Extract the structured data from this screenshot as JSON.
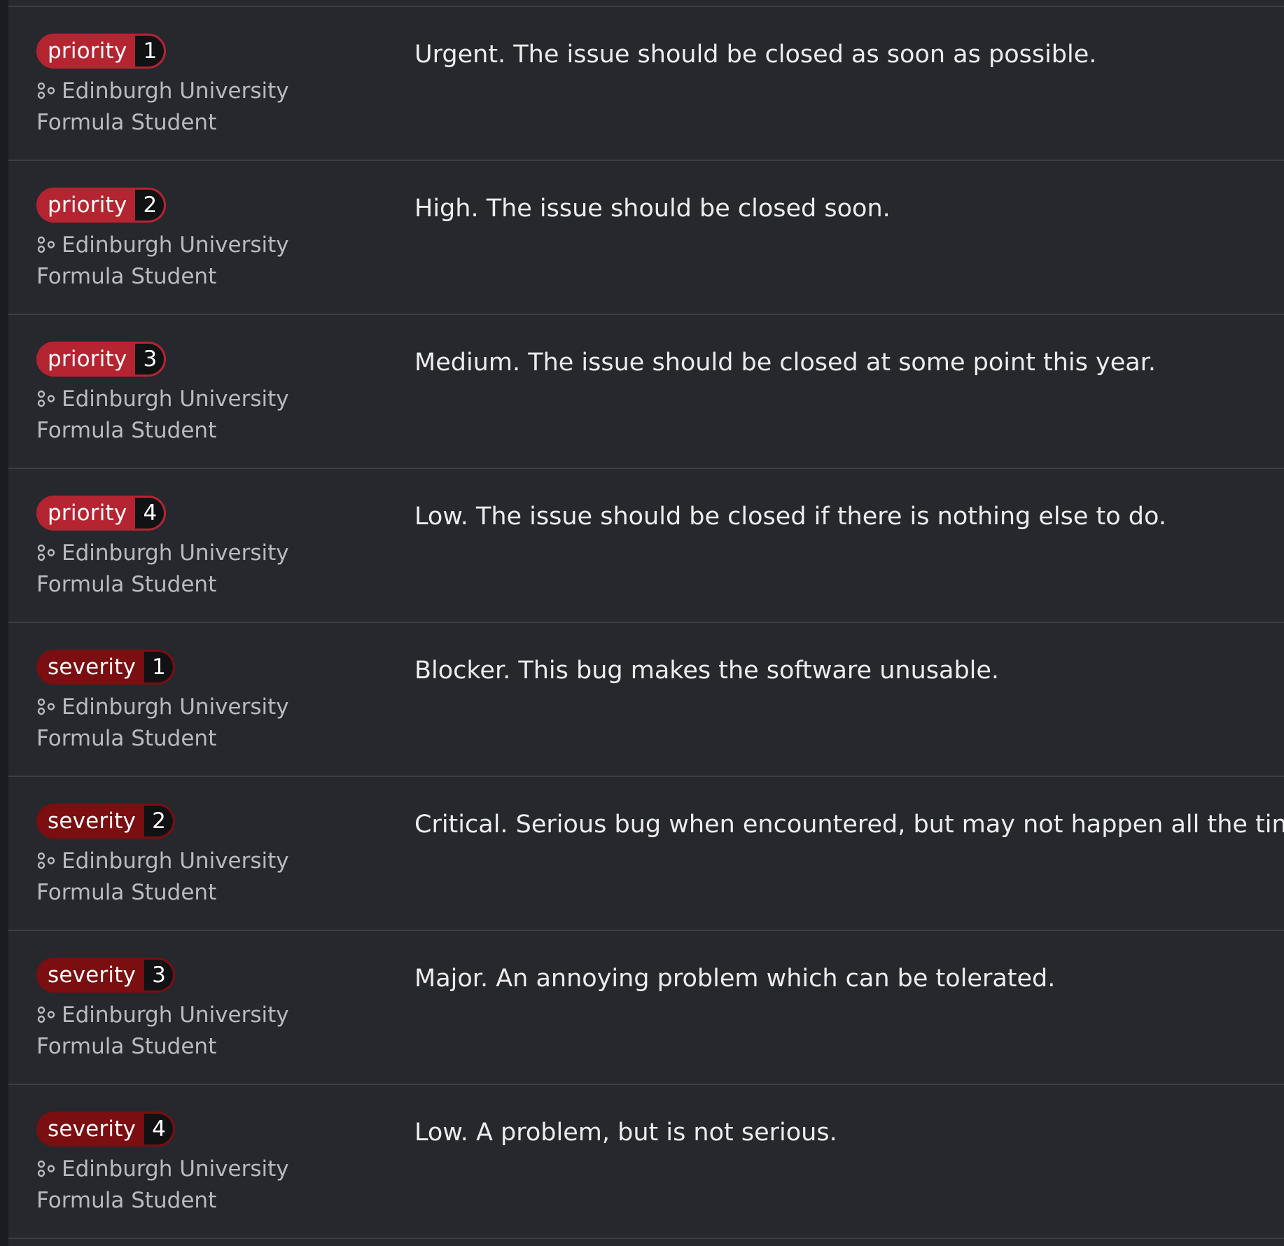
{
  "labels": [
    {
      "scope": "priority",
      "value": "1",
      "kind": "priority",
      "namespace": "Edinburgh University Formula Student",
      "description": "Urgent. The issue should be closed as soon as possible."
    },
    {
      "scope": "priority",
      "value": "2",
      "kind": "priority",
      "namespace": "Edinburgh University Formula Student",
      "description": "High. The issue should be closed soon."
    },
    {
      "scope": "priority",
      "value": "3",
      "kind": "priority",
      "namespace": "Edinburgh University Formula Student",
      "description": "Medium. The issue should be closed at some point this year."
    },
    {
      "scope": "priority",
      "value": "4",
      "kind": "priority",
      "namespace": "Edinburgh University Formula Student",
      "description": "Low. The issue should be closed if there is nothing else to do."
    },
    {
      "scope": "severity",
      "value": "1",
      "kind": "severity",
      "namespace": "Edinburgh University Formula Student",
      "description": "Blocker. This bug makes the software unusable."
    },
    {
      "scope": "severity",
      "value": "2",
      "kind": "severity",
      "namespace": "Edinburgh University Formula Student",
      "description": "Critical. Serious bug when encountered, but may not happen all the time."
    },
    {
      "scope": "severity",
      "value": "3",
      "kind": "severity",
      "namespace": "Edinburgh University Formula Student",
      "description": "Major. An annoying problem which can be tolerated."
    },
    {
      "scope": "severity",
      "value": "4",
      "kind": "severity",
      "namespace": "Edinburgh University Formula Student",
      "description": "Low. A problem, but is not serious."
    }
  ],
  "colors": {
    "priority": "#b52431",
    "severity": "#7a0e10",
    "background": "#27282e",
    "divider": "#3c3d44"
  },
  "icons": {
    "namespace": "group-icon"
  }
}
